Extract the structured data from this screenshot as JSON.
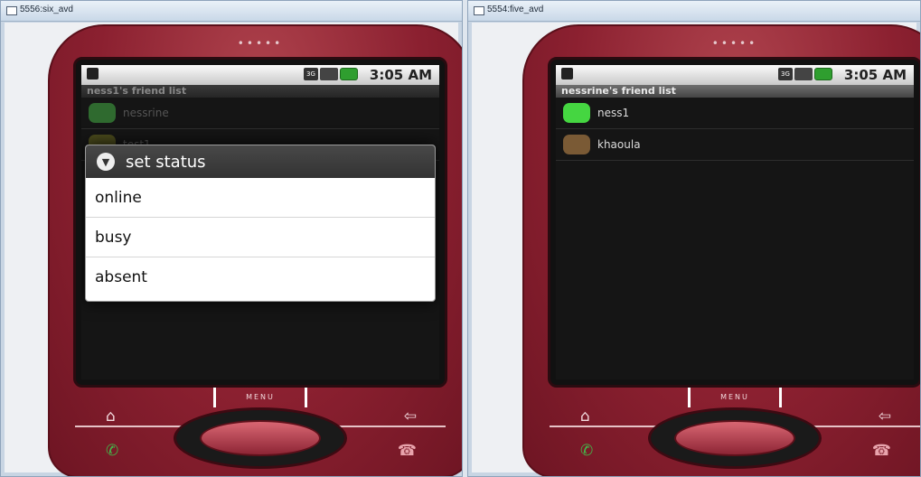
{
  "left_window": {
    "title": "5556:six_avd",
    "phone": {
      "status_time": "3:05 AM",
      "list_title": "ness1's friend list",
      "friends": [
        {
          "name": "nessrine",
          "status_color": "#2f9a2f"
        },
        {
          "name": "test1",
          "status_color": "#5a5a20"
        }
      ],
      "dialog": {
        "title": "set status",
        "options": [
          "online",
          "busy",
          "absent"
        ]
      },
      "menu_label": "MENU"
    }
  },
  "right_window": {
    "title": "5554:five_avd",
    "phone": {
      "status_time": "3:05 AM",
      "list_title": "nessrine's friend list",
      "friends": [
        {
          "name": "ness1",
          "status_color": "#45d641"
        },
        {
          "name": "khaoula",
          "status_color": "#7a5a35"
        }
      ],
      "menu_label": "MENU"
    }
  },
  "icons": {
    "home": "⌂",
    "back": "⇦",
    "call": "✆",
    "end_call": "☎"
  }
}
